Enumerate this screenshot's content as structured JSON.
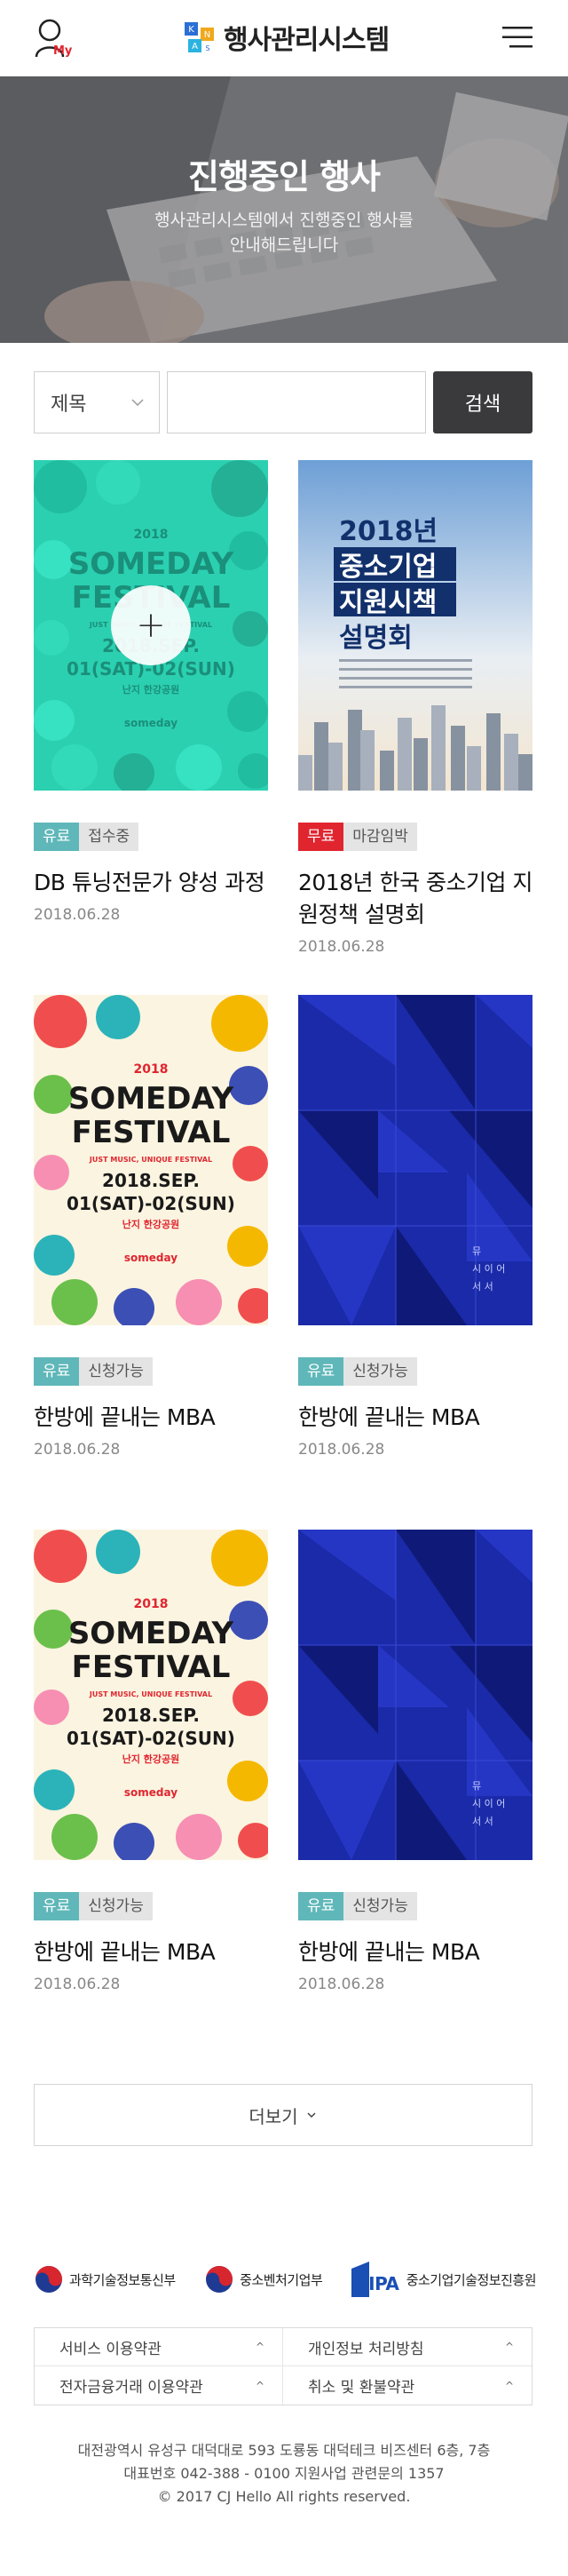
{
  "header": {
    "my_label": "My",
    "logo_text": "행사관리시스템",
    "logo_mark_letters": [
      "K",
      "N",
      "A",
      "S"
    ],
    "brand_color": "#e0252f"
  },
  "hero": {
    "title": "진행중인 행사",
    "subtitle_line1": "행사관리시스템에서 진행중인 행사를",
    "subtitle_line2": "안내해드립니다"
  },
  "search": {
    "select_value": "제목",
    "input_value": "",
    "input_placeholder": "",
    "button_label": "검색"
  },
  "events": [
    {
      "poster": "festival-teal",
      "poster_text": {
        "year": "2018",
        "line1": "SOMEDAY",
        "line2": "FESTIVAL",
        "tag": "JUST MUSIC, UNIQUE FESTIVAL",
        "date1": "2018.SEP.",
        "date2": "01(SAT)-02(SUN)",
        "place": "난지 한강공원",
        "brand": "someday"
      },
      "type_label": "유료",
      "type_color": "#5fb7b9",
      "status_label": "접수중",
      "title": "DB 튜닝전문가 양성 과정",
      "date": "2018.06.28",
      "hover_icon": "+"
    },
    {
      "poster": "city",
      "poster_text": {
        "line1": "2018년",
        "line2": "중소기업",
        "line3": "지원시책",
        "line4": "설명회"
      },
      "type_label": "무료",
      "type_color": "#e0252f",
      "status_label": "마감임박",
      "title": "2018년 한국 중소기업 지원정책 설명회",
      "date": "2018.06.28"
    },
    {
      "poster": "festival",
      "poster_text": {
        "year": "2018",
        "line1": "SOMEDAY",
        "line2": "FESTIVAL",
        "tag": "JUST MUSIC, UNIQUE FESTIVAL",
        "date1": "2018.SEP.",
        "date2": "01(SAT)-02(SUN)",
        "place": "난지 한강공원",
        "brand": "someday"
      },
      "type_label": "유료",
      "type_color": "#5fb7b9",
      "status_label": "신청가능",
      "title": "한방에 끝내는 MBA",
      "date": "2018.06.28"
    },
    {
      "poster": "blue",
      "poster_text": {
        "line1": "뮤",
        "line2": "시 이 어",
        "line3": "서 서"
      },
      "type_label": "유료",
      "type_color": "#5fb7b9",
      "status_label": "신청가능",
      "title": "한방에 끝내는 MBA",
      "date": "2018.06.28"
    },
    {
      "poster": "festival",
      "poster_text": {
        "year": "2018",
        "line1": "SOMEDAY",
        "line2": "FESTIVAL",
        "tag": "JUST MUSIC, UNIQUE FESTIVAL",
        "date1": "2018.SEP.",
        "date2": "01(SAT)-02(SUN)",
        "place": "난지 한강공원",
        "brand": "someday"
      },
      "type_label": "유료",
      "type_color": "#5fb7b9",
      "status_label": "신청가능",
      "title": "한방에 끝내는 MBA",
      "date": "2018.06.28"
    },
    {
      "poster": "blue",
      "poster_text": {
        "line1": "뮤",
        "line2": "시 이 어",
        "line3": "서 서"
      },
      "type_label": "유료",
      "type_color": "#5fb7b9",
      "status_label": "신청가능",
      "title": "한방에 끝내는 MBA",
      "date": "2018.06.28"
    }
  ],
  "more_label": "더보기",
  "footer": {
    "partners": [
      {
        "name": "과학기술정보통신부",
        "icon": "taegeuk-icon"
      },
      {
        "name": "중소벤처기업부",
        "icon": "taegeuk-icon"
      },
      {
        "name": "중소기업기술정보진흥원",
        "icon": "tipa-logo",
        "mark_text": "TIPA"
      }
    ],
    "links": [
      {
        "label": "서비스 이용약관",
        "caret": "^"
      },
      {
        "label": "개인정보 처리방침",
        "caret": "^"
      },
      {
        "label": "전자금융거래 이용약관",
        "caret": "^"
      },
      {
        "label": "취소 및 환불약관",
        "caret": "^"
      }
    ],
    "address_line1": "대전광역시 유성구 대덕대로 593 도룡동 대덕테크 비즈센터 6층, 7층",
    "address_line2": "대표번호 042-388 - 0100  지원사업 관련문의 1357",
    "copyright": "© 2017 CJ Hello All rights reserved."
  }
}
